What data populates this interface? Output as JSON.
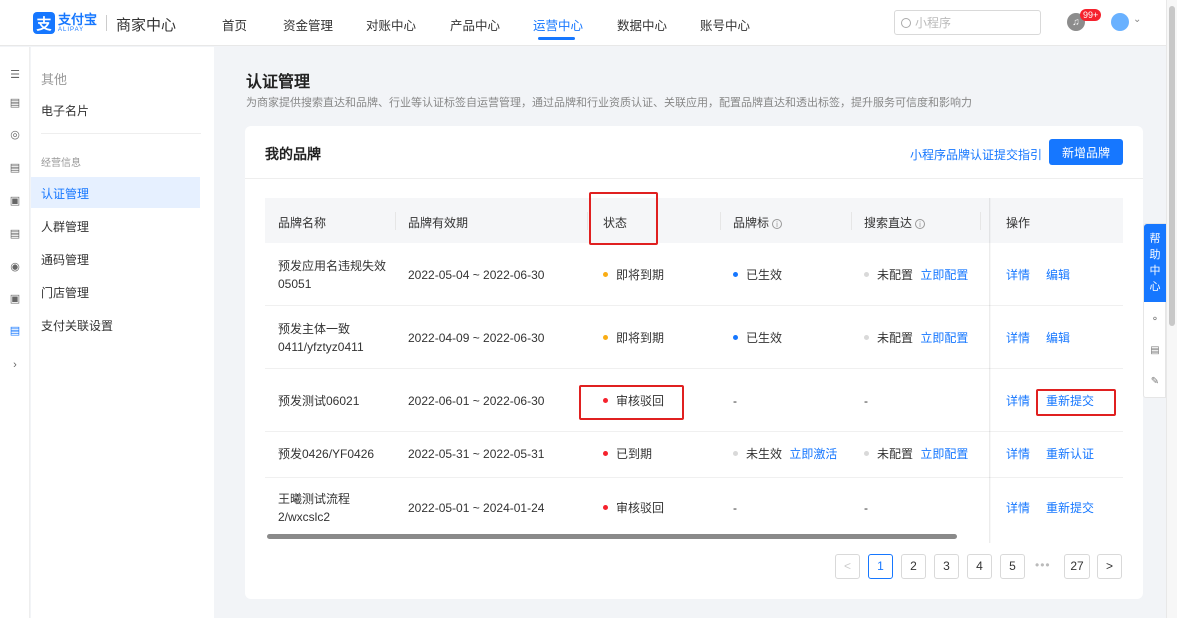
{
  "header": {
    "logo_char": "支",
    "logo_cn": "支付宝",
    "logo_en": "ALIPAY",
    "portal": "商家中心",
    "nav": [
      "首页",
      "资金管理",
      "对账中心",
      "产品中心",
      "运营中心",
      "数据中心",
      "账号中心"
    ],
    "active_nav": "运营中心",
    "search_placeholder": "小程序",
    "notification_badge": "99+",
    "accent": "#1677ff"
  },
  "rail_icons": [
    "menu-icon",
    "chart-icon",
    "compass-icon",
    "receipt-icon",
    "gift-icon",
    "document-icon",
    "camera-icon",
    "wallet-icon",
    "brand-icon",
    "expand-chevron-icon"
  ],
  "sidebar": {
    "group": "其他",
    "item_card": "电子名片",
    "section": "经营信息",
    "items": [
      "认证管理",
      "人群管理",
      "通码管理",
      "门店管理",
      "支付关联设置"
    ],
    "active": "认证管理"
  },
  "page": {
    "title": "认证管理",
    "desc": "为商家提供搜索直达和品牌、行业等认证标签自运营管理，通过品牌和行业资质认证、关联应用，配置品牌直达和透出标签，提升服务可信度和影响力"
  },
  "card": {
    "title": "我的品牌",
    "guide_link": "小程序品牌认证提交指引",
    "add_button": "新增品牌"
  },
  "table": {
    "headers": {
      "name": "品牌名称",
      "validity": "品牌有效期",
      "status": "状态",
      "brand_mark": "品牌标",
      "search": "搜索直达",
      "ops": "操作"
    },
    "info_glyph": "i",
    "rows": [
      {
        "name1": "预发应用名违规失效",
        "name2": "05051",
        "validity": "2022-05-04 ~ 2022-06-30",
        "status": "即将到期",
        "status_color": "#faad14",
        "mark": "已生效",
        "mark_color": "#1677ff",
        "mark_link": "",
        "search": "未配置",
        "search_link": "立即配置",
        "op1": "详情",
        "op2": "编辑"
      },
      {
        "name1": "预发主体一致",
        "name2": "0411/yfztyz0411",
        "validity": "2022-04-09 ~ 2022-06-30",
        "status": "即将到期",
        "status_color": "#faad14",
        "mark": "已生效",
        "mark_color": "#1677ff",
        "mark_link": "",
        "search": "未配置",
        "search_link": "立即配置",
        "op1": "详情",
        "op2": "编辑"
      },
      {
        "name1": "预发测试06021",
        "name2": "",
        "validity": "2022-06-01 ~ 2022-06-30",
        "status": "审核驳回",
        "status_color": "#f5222d",
        "mark_dash": "-",
        "search_dash": "-",
        "op1": "详情",
        "op2": "重新提交"
      },
      {
        "name1": "预发0426/YF0426",
        "name2": "",
        "validity": "2022-05-31 ~ 2022-05-31",
        "status": "已到期",
        "status_color": "#f5222d",
        "mark": "未生效",
        "mark_color": "#d9d9d9",
        "mark_link": "立即激活",
        "search": "未配置",
        "search_link": "立即配置",
        "op1": "详情",
        "op2": "重新认证"
      },
      {
        "name1": "王曦测试流程",
        "name2": "2/wxcslc2",
        "validity": "2022-05-01 ~ 2024-01-24",
        "status": "审核驳回",
        "status_color": "#f5222d",
        "mark_dash": "-",
        "search_dash": "-",
        "op1": "详情",
        "op2": "重新提交"
      }
    ]
  },
  "pagination": {
    "prev": "<",
    "pages": [
      "1",
      "2",
      "3",
      "4",
      "5"
    ],
    "ellipsis": "•••",
    "last": "27",
    "next": ">",
    "current": "1"
  },
  "help": {
    "chars": [
      "帮",
      "助",
      "中",
      "心"
    ],
    "icons": [
      "headset-icon",
      "new-icon",
      "edit-icon"
    ]
  }
}
